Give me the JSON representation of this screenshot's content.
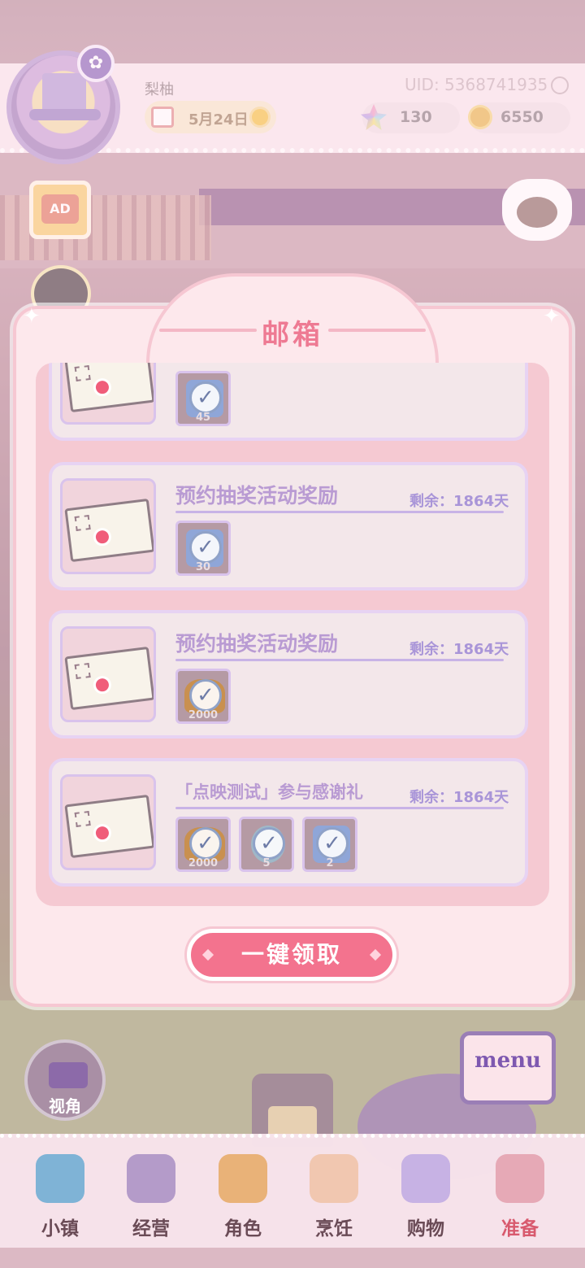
{
  "header": {
    "player_name": "梨柚",
    "uid": "UID: 5368741935",
    "date": "5月24日",
    "gems": "130",
    "coins": "6550"
  },
  "side": {
    "ad_label": "AD"
  },
  "mailbox": {
    "title": "邮箱",
    "mails": [
      {
        "title": "",
        "remaining": "",
        "rewards": [
          {
            "type": "gem",
            "qty": "45"
          }
        ]
      },
      {
        "title": "预约抽奖活动奖励",
        "remaining": "剩余：1864天",
        "rewards": [
          {
            "type": "gem",
            "qty": "30"
          }
        ]
      },
      {
        "title": "预约抽奖活动奖励",
        "remaining": "剩余：1864天",
        "rewards": [
          {
            "type": "bread",
            "qty": "2000"
          }
        ]
      },
      {
        "title": "「点映测试」参与感谢礼",
        "remaining": "剩余：1864天",
        "rewards": [
          {
            "type": "bread",
            "qty": "2000"
          },
          {
            "type": "egg",
            "qty": "5"
          },
          {
            "type": "gem",
            "qty": "2"
          }
        ]
      }
    ],
    "claim_all_label": "一键领取"
  },
  "widgets": {
    "camera_label": "视角",
    "menu_label": "menu"
  },
  "nav": [
    {
      "label": "小镇",
      "icon": "map-icon",
      "color": "#7fb3d6"
    },
    {
      "label": "经营",
      "icon": "lock-icon",
      "color": "#b49bc9"
    },
    {
      "label": "角色",
      "icon": "character-icon",
      "color": "#e9b278"
    },
    {
      "label": "烹饪",
      "icon": "cooking-icon",
      "color": "#f1c7b0"
    },
    {
      "label": "购物",
      "icon": "shopping-bag-icon",
      "color": "#c7b2e4"
    },
    {
      "label": "准备",
      "icon": "picnic-basket-icon",
      "color": "#e6a9b6"
    }
  ],
  "colors": {
    "accent": "#ee7a93",
    "claim_button": "#f3738e",
    "remaining_text": "#a995d8"
  }
}
